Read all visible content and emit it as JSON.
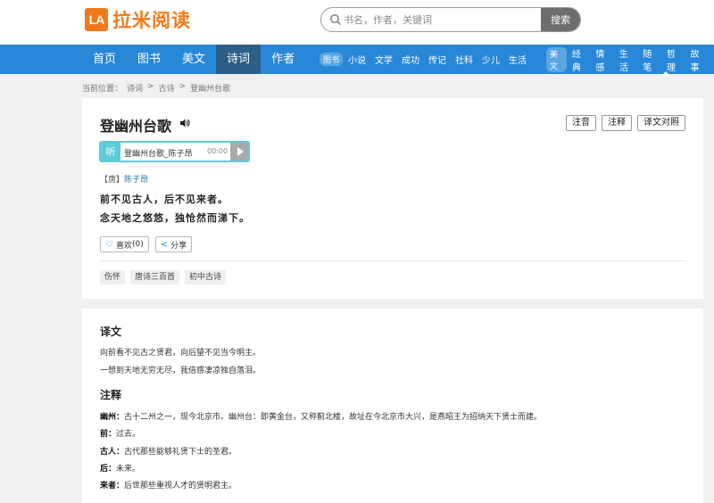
{
  "header": {
    "logo_mark": "LA",
    "logo_text": "拉米阅读",
    "search_placeholder": "书名，作者，关键词",
    "search_button": "搜索"
  },
  "nav": {
    "main": [
      {
        "label": "首页",
        "active": false
      },
      {
        "label": "图书",
        "active": false
      },
      {
        "label": "美文",
        "active": false
      },
      {
        "label": "诗词",
        "active": true
      },
      {
        "label": "作者",
        "active": false
      }
    ],
    "books_badge": "图书",
    "books_links": [
      "小说",
      "文学",
      "成功",
      "传记",
      "社科",
      "少儿",
      "生活"
    ],
    "essay_badge": "美文",
    "essay_links": [
      "经典",
      "情感",
      "生活",
      "随笔",
      "哲理",
      "故事"
    ]
  },
  "breadcrumb": {
    "prefix": "当前位置：",
    "items": [
      "诗词",
      "古诗",
      "登幽州台歌"
    ],
    "separator": ">"
  },
  "poem": {
    "title": "登幽州台歌",
    "tools": [
      "注音",
      "注释",
      "译文对照"
    ],
    "player": {
      "ting": "听",
      "track": "登幽州台歌_陈子昂",
      "time": "00:00"
    },
    "dynasty": "【唐】",
    "author": "陈子昂",
    "lines": [
      "前不见古人，后不见来者。",
      "念天地之悠悠，独怆然而涕下。"
    ],
    "like_label": "喜欢",
    "like_count": "(0)",
    "share_label": "分享",
    "tags": [
      "伤怀",
      "唐诗三百首",
      "初中古诗"
    ]
  },
  "translation": {
    "heading": "译文",
    "lines": [
      "向前看不见古之贤君，向后望不见当今明主。",
      "一想到天地无穷无尽，我倍感凄凉独自落泪。"
    ]
  },
  "notes": {
    "heading": "注释",
    "items": [
      {
        "term": "幽州：",
        "text": "古十二州之一，现今北京市。幽州台：即黄金台，又称蓟北楼，故址在今北京市大兴，是燕昭王为招纳天下贤士而建。"
      },
      {
        "term": "前：",
        "text": "过去。"
      },
      {
        "term": "古人：",
        "text": "古代那些能够礼贤下士的圣君。"
      },
      {
        "term": "后：",
        "text": "未来。"
      },
      {
        "term": "来者：",
        "text": "后世那些重视人才的贤明君主。"
      }
    ]
  }
}
